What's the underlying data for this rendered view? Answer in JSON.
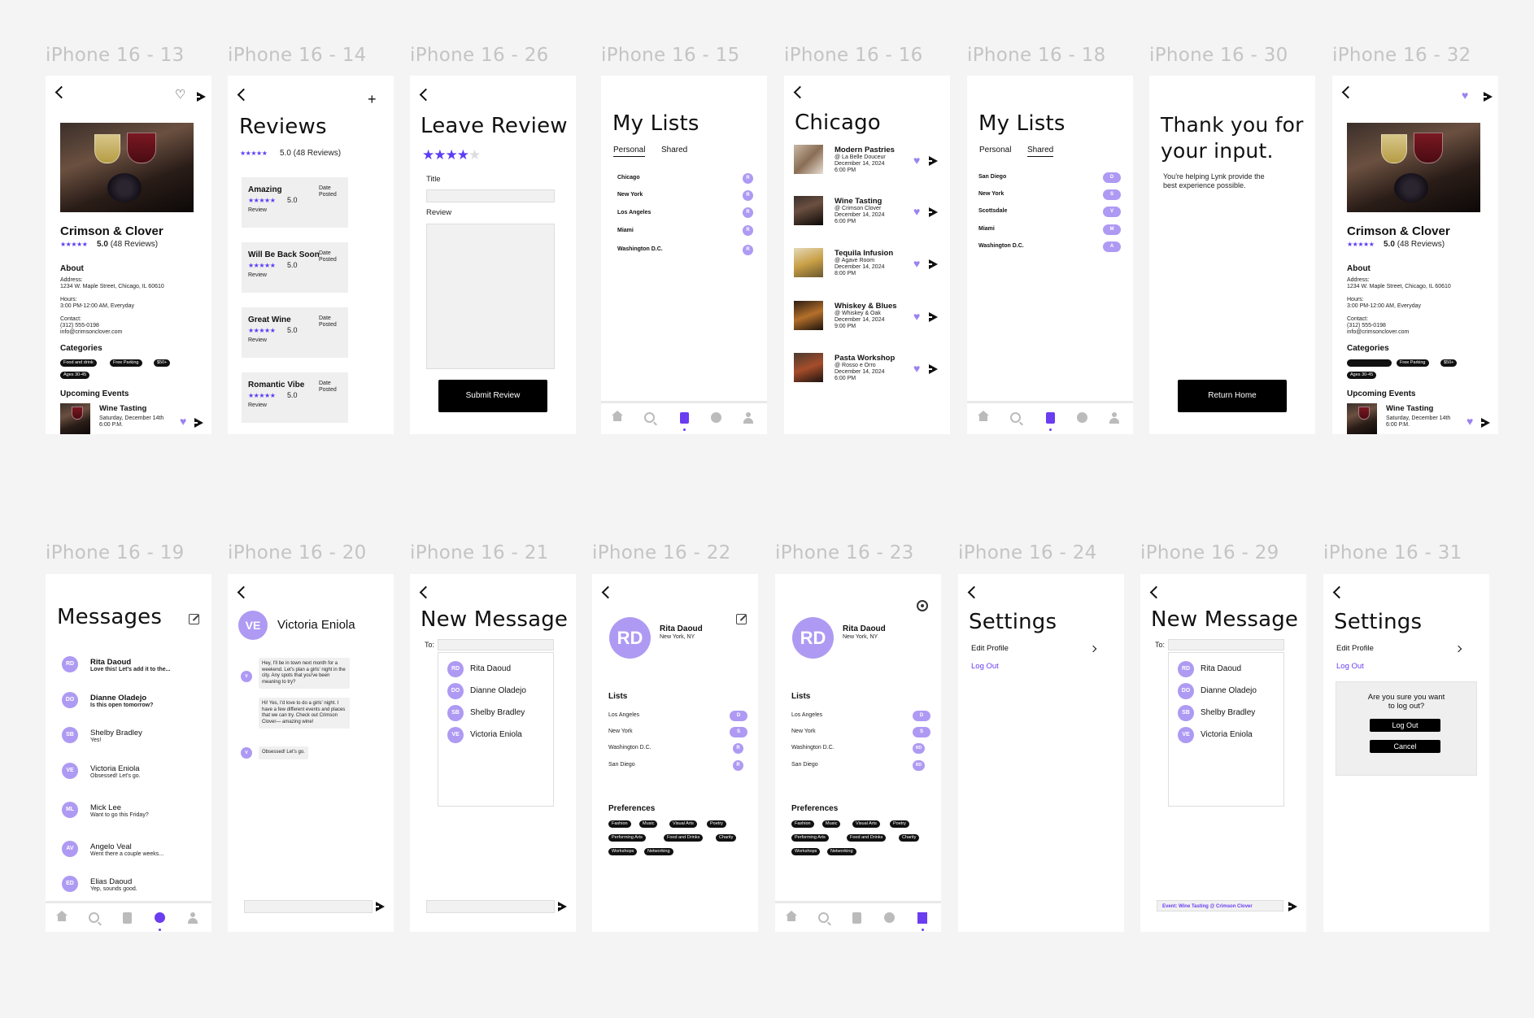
{
  "labels": {
    "f13": "iPhone 16 - 13",
    "f14": "iPhone 16 - 14",
    "f26": "iPhone 16 - 26",
    "f15": "iPhone 16 - 15",
    "f16": "iPhone 16 - 16",
    "f18": "iPhone 16 - 18",
    "f30": "iPhone 16 - 30",
    "f32": "iPhone 16 - 32",
    "f19": "iPhone 16 - 19",
    "f20": "iPhone 16 - 20",
    "f21": "iPhone 16 - 21",
    "f22": "iPhone 16 - 22",
    "f23": "iPhone 16 - 23",
    "f24": "iPhone 16 - 24",
    "f29": "iPhone 16 - 29",
    "f31": "iPhone 16 - 31"
  },
  "venue": {
    "name": "Crimson & Clover",
    "stars": "★★★★★",
    "rating": "5.0",
    "reviews": "(48 Reviews)",
    "about": "About",
    "address_label": "Address:",
    "address": "1234 W. Maple Street, Chicago, IL 60610",
    "hours_label": "Hours:",
    "hours": "3:00 PM-12:00 AM, Everyday",
    "contact_label": "Contact:",
    "phone": "(312) 555-0198",
    "email": "info@crimsonclover.com",
    "categories": "Categories",
    "cat1": "Food and drink",
    "cat2": "Free Parking",
    "cat3": "$50+",
    "cat4": "Ages 30-45",
    "upcoming": "Upcoming Events",
    "event_name": "Wine Tasting",
    "event_date": "Saturday, December 14th",
    "event_time": "6:00 P.M."
  },
  "reviews": {
    "title": "Reviews",
    "stars": "★★★★★",
    "summary": "5.0 (48 Reviews)",
    "date_posted": "Date Posted",
    "score": "5.0",
    "review": "Review",
    "r1": "Amazing",
    "r2": "Will Be Back Soon",
    "r3": "Great Wine",
    "r4": "Romantic Vibe"
  },
  "leave_review": {
    "title": "Leave Review",
    "stars_filled": "★★★★",
    "star_empty": "★",
    "title_label": "Title",
    "review_label": "Review",
    "submit": "Submit Review"
  },
  "lists": {
    "title": "My Lists",
    "personal": "Personal",
    "shared": "Shared",
    "personal_items": [
      "Chicago",
      "New York",
      "Los Angeles",
      "Miami",
      "Washington D.C."
    ],
    "shared_items": [
      "San Diego",
      "New York",
      "Scottsdale",
      "Miami",
      "Washington D.C."
    ],
    "shared_badges": [
      "D",
      "S",
      "V",
      "M",
      "A"
    ],
    "r": "R"
  },
  "chicago": {
    "title": "Chicago",
    "events": [
      {
        "name": "Modern Pastries",
        "place": "@ La Belle Douceur",
        "date": "December 14, 2024",
        "time": "6:00 PM"
      },
      {
        "name": "Wine Tasting",
        "place": "@ Crimson Clover",
        "date": "December 14, 2024",
        "time": "6:00 PM"
      },
      {
        "name": "Tequila Infusion",
        "place": "@ Agave Room",
        "date": "December 14, 2024",
        "time": "8:00 PM"
      },
      {
        "name": "Whiskey & Blues",
        "place": "@ Whiskey & Oak",
        "date": "December 14, 2024",
        "time": "9:00 PM"
      },
      {
        "name": "Pasta Workshop",
        "place": "@ Rosso e Orro",
        "date": "December 14, 2024",
        "time": "6:00 PM"
      }
    ]
  },
  "thanks": {
    "title1": "Thank you for",
    "title2": "your input.",
    "sub1": "You're helping Lynk provide the",
    "sub2": "best experience possible.",
    "button": "Return Home"
  },
  "messages": {
    "title": "Messages",
    "items": [
      {
        "init": "RD",
        "name": "Rita Daoud",
        "preview": "Love this! Let's add it to the..."
      },
      {
        "init": "DO",
        "name": "Dianne Oladejo",
        "preview": "Is this open tomorrow?"
      },
      {
        "init": "SB",
        "name": "Shelby Bradley",
        "preview": "Yes!"
      },
      {
        "init": "VE",
        "name": "Victoria Eniola",
        "preview": "Obsessed! Let's go."
      },
      {
        "init": "ML",
        "name": "Mick Lee",
        "preview": "Want to go this Friday?"
      },
      {
        "init": "AV",
        "name": "Angelo Veal",
        "preview": "Went there a couple weeks..."
      },
      {
        "init": "ED",
        "name": "Elias Daoud",
        "preview": "Yep, sounds good."
      }
    ]
  },
  "chat": {
    "init": "VE",
    "name": "Victoria Eniola",
    "v": "V",
    "m1": "Hey, I'll be in town next month for a weekend. Let's plan a girls' night in the city. Any spots that you've been meaning to try?",
    "m2": "Hi! Yes, I'd love to do a girls' night. I have a few different events and places that we can try. Check out Crimson Clover— amazing wine!",
    "m3": "Obsessed! Let's go."
  },
  "new_message": {
    "title": "New Message",
    "to": "To:",
    "contacts": [
      {
        "init": "RD",
        "name": "Rita Daoud"
      },
      {
        "init": "DO",
        "name": "Dianne Oladejo"
      },
      {
        "init": "SB",
        "name": "Shelby Bradley"
      },
      {
        "init": "VE",
        "name": "Victoria Eniola"
      }
    ],
    "event_chip": "Event: Wine Tasting @ Crimson Clover"
  },
  "profile": {
    "init": "RD",
    "name": "Rita Daoud",
    "location": "New York, NY",
    "lists": "Lists",
    "list_items": [
      "Los Angeles",
      "New York",
      "Washington D.C.",
      "San Diego"
    ],
    "list_badges": [
      "D",
      "S",
      "R",
      "R"
    ],
    "list_badges23": [
      "D",
      "S",
      "RD",
      "RD"
    ],
    "preferences": "Preferences",
    "prefs": [
      "Fashion",
      "Music",
      "Visual Arts",
      "Poetry",
      "Performing Arts",
      "Food and Drinks",
      "Charity",
      "Workshops",
      "Networking"
    ]
  },
  "settings": {
    "title": "Settings",
    "edit": "Edit Profile",
    "logout": "Log Out",
    "confirm1": "Are you sure you want",
    "confirm2": "to log out?",
    "logout_btn": "Log Out",
    "cancel": "Cancel"
  },
  "colors": {
    "accent": "#6a3df0",
    "avatar": "#ae9af3",
    "heart": "#9b82f0"
  }
}
